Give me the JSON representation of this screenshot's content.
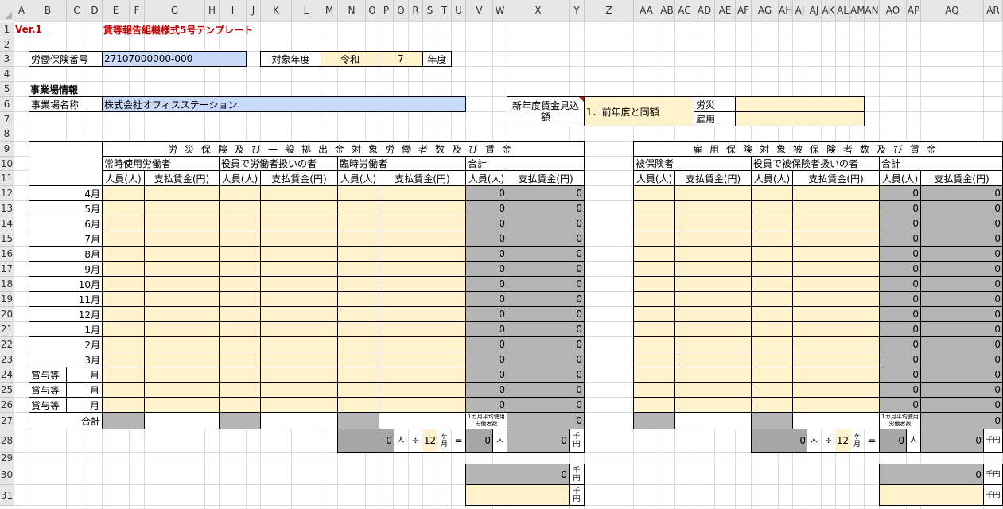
{
  "sheet": {
    "columns": [
      "A",
      "B",
      "C",
      "D",
      "E",
      "F",
      "G",
      "H",
      "I",
      "J",
      "K",
      "L",
      "M",
      "N",
      "O",
      "P",
      "Q",
      "R",
      "S",
      "T",
      "U",
      "V",
      "W",
      "X",
      "Y",
      "Z",
      "AA",
      "AB",
      "AC",
      "AD",
      "AE",
      "AF",
      "AG",
      "AH",
      "AI",
      "AJ",
      "AK",
      "AL",
      "AM",
      "AN",
      "AO",
      "AP",
      "AQ",
      "AR"
    ],
    "rows": [
      "1",
      "2",
      "3",
      "4",
      "5",
      "6",
      "7",
      "8",
      "9",
      "10",
      "11",
      "12",
      "13",
      "14",
      "15",
      "16",
      "17",
      "18",
      "19",
      "20",
      "21",
      "22",
      "23",
      "24",
      "25",
      "26",
      "27",
      "28",
      "29",
      "30",
      "31"
    ]
  },
  "title": {
    "version": "Ver.1",
    "name": "賃等報告組機様式5号テンプレート"
  },
  "insurance_no": {
    "label": "労働保険番号",
    "value": "27107000000-000"
  },
  "target_year": {
    "label": "対象年度",
    "era": "令和",
    "year": "7",
    "suffix": "年度"
  },
  "workplace": {
    "section": "事業場情報",
    "name_label": "事業場名称",
    "name_value": "株式会社オフィスステーション"
  },
  "estimate": {
    "label": "新年度賃金見込額",
    "option": "1．前年度と同額",
    "rousai_label": "労災",
    "koyou_label": "雇用"
  },
  "left_table": {
    "title": "労災保険及び一般拠出金対象労働者数及び賃金",
    "groups": [
      "常時使用労働者",
      "役員で労働者扱いの者",
      "臨時労働者",
      "合計"
    ],
    "people_header": "人員(人)",
    "wage_header": "支払賃金(円)",
    "months": [
      "4月",
      "5月",
      "6月",
      "7月",
      "8月",
      "9月",
      "10月",
      "11月",
      "12月",
      "1月",
      "2月",
      "3月"
    ],
    "bonus_label": "賞与等",
    "bonus_month_unit": "月",
    "row_total_people": "0",
    "row_total_wage": "0",
    "total_label": "合計",
    "avg_label": "1カ月平均使用労働者数",
    "grand_total_wage": "0",
    "calc": {
      "total_people": "0",
      "people_unit": "人",
      "divide": "÷",
      "months": "12",
      "months_unit": "ヶ月",
      "equals": "=",
      "average": "0",
      "average_unit": "人",
      "wage_thousand": "0",
      "thousand_yen": "千円"
    },
    "summary": {
      "value1": "0",
      "unit1": "千円",
      "unit2": "千円"
    }
  },
  "right_table": {
    "title": "雇用保険対象被保険者数及び賃金",
    "groups": [
      "被保険者",
      "役員で被保険者扱いの者",
      "合計"
    ],
    "people_header": "人員(人)",
    "wage_header": "支払賃金(円)",
    "row_total_people": "0",
    "row_total_wage": "0",
    "avg_label": "1カ月平均使用労働者数",
    "grand_total_wage": "0",
    "calc": {
      "total_people": "0",
      "people_unit": "人",
      "divide": "÷",
      "months": "12",
      "months_unit": "ヶ月",
      "equals": "=",
      "average": "0",
      "average_unit": "人",
      "wage_thousand": "0",
      "thousand_yen": "千円"
    },
    "summary": {
      "value1": "0",
      "unit1": "千円",
      "unit2": "千円"
    }
  },
  "colors": {
    "input_blue": "#c9daf8",
    "input_beige": "#fff2cc",
    "formula_gray": "#b4b4b4",
    "title_red": "#c00000"
  }
}
